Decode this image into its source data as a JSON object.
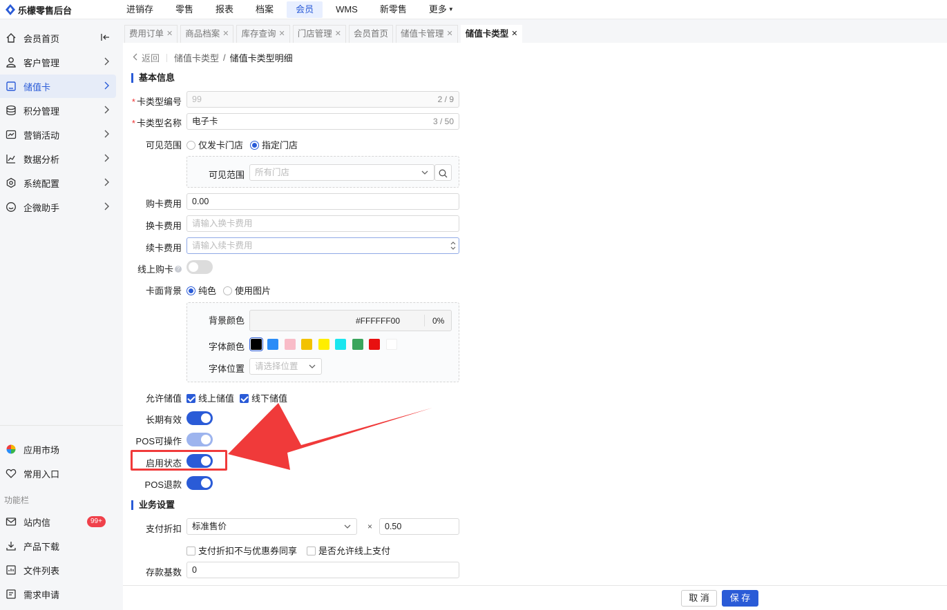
{
  "app": {
    "title": "乐檬零售后台"
  },
  "topnav": [
    {
      "label": "进销存",
      "active": false
    },
    {
      "label": "零售",
      "active": false
    },
    {
      "label": "报表",
      "active": false
    },
    {
      "label": "档案",
      "active": false
    },
    {
      "label": "会员",
      "active": true
    },
    {
      "label": "WMS",
      "active": false
    },
    {
      "label": "新零售",
      "active": false
    },
    {
      "label": "更多",
      "active": false
    }
  ],
  "sidebar": {
    "items": [
      {
        "label": "会员首页",
        "icon": "home-icon"
      },
      {
        "label": "客户管理",
        "icon": "user-icon"
      },
      {
        "label": "储值卡",
        "icon": "card-icon",
        "active": true
      },
      {
        "label": "积分管理",
        "icon": "coins-icon"
      },
      {
        "label": "营销活动",
        "icon": "campaign-icon"
      },
      {
        "label": "数据分析",
        "icon": "chart-icon"
      },
      {
        "label": "系统配置",
        "icon": "settings-icon"
      },
      {
        "label": "企微助手",
        "icon": "chat-icon"
      }
    ],
    "bottom": [
      {
        "label": "应用市场",
        "icon": "app-market-icon"
      },
      {
        "label": "常用入口",
        "icon": "heart-icon"
      }
    ],
    "toolbar_title": "功能栏",
    "tools": [
      {
        "label": "站内信",
        "icon": "mail-icon",
        "badge": "99+"
      },
      {
        "label": "产品下载",
        "icon": "download-icon"
      },
      {
        "label": "文件列表",
        "icon": "file-list-icon"
      },
      {
        "label": "需求申请",
        "icon": "request-icon"
      }
    ]
  },
  "tabs": [
    {
      "label": "费用订单"
    },
    {
      "label": "商品档案"
    },
    {
      "label": "库存查询"
    },
    {
      "label": "门店管理"
    },
    {
      "label": "会员首页"
    },
    {
      "label": "储值卡管理"
    },
    {
      "label": "储值卡类型",
      "active": true
    }
  ],
  "breadcrumb": {
    "back": "返回",
    "parent": "储值卡类型",
    "sep": "/",
    "current": "储值卡类型明细"
  },
  "sections": {
    "basic": "基本信息",
    "business": "业务设置"
  },
  "form": {
    "type_code": {
      "label": "卡类型编号",
      "value": "99",
      "count": "2 / 9"
    },
    "type_name": {
      "label": "卡类型名称",
      "value": "电子卡",
      "count": "3 / 50"
    },
    "visible_scope": {
      "label": "可见范围",
      "opt1": "仅发卡门店",
      "opt2": "指定门店",
      "selected": "指定门店"
    },
    "scope_select": {
      "label": "可见范围",
      "placeholder": "所有门店"
    },
    "buy_fee": {
      "label": "购卡费用",
      "value": "0.00"
    },
    "change_fee": {
      "label": "换卡费用",
      "placeholder": "请输入换卡费用"
    },
    "renew_fee": {
      "label": "续卡费用",
      "placeholder": "请输入续卡费用"
    },
    "online_buy": {
      "label": "线上购卡",
      "on": false
    },
    "card_bg": {
      "label": "卡面背景",
      "opt1": "纯色",
      "opt2": "使用图片",
      "selected": "纯色"
    },
    "bg_color": {
      "label": "背景颜色",
      "value": "#FFFFFF00",
      "alpha": "0%"
    },
    "font_color": {
      "label": "字体颜色",
      "colors": [
        "#000000",
        "#2a8cf7",
        "#f9bcc8",
        "#f2c200",
        "#ffee00",
        "#1be6ef",
        "#3aa55c",
        "#e81010",
        "#ffffff"
      ],
      "selected": "#000000"
    },
    "font_pos": {
      "label": "字体位置",
      "placeholder": "请选择位置"
    },
    "allow_recharge": {
      "label": "允许储值",
      "opt1": "线上储值",
      "opt2": "线下储值"
    },
    "long_valid": {
      "label": "长期有效",
      "on": true
    },
    "pos_operate": {
      "label": "POS可操作",
      "on": true
    },
    "enable_status": {
      "label": "启用状态",
      "on": true
    },
    "pos_refund": {
      "label": "POS退款",
      "on": true
    },
    "pay_discount": {
      "label": "支付折扣",
      "value": "标准售价",
      "times": "×",
      "rate": "0.50"
    },
    "discount_opts": {
      "opt1": "支付折扣不与优惠券同享",
      "opt2": "是否允许线上支付"
    },
    "deposit_base": {
      "label": "存款基数",
      "value": "0"
    }
  },
  "footer": {
    "cancel": "取 消",
    "save": "保 存"
  },
  "annotation": {
    "color": "#f03a3a"
  }
}
